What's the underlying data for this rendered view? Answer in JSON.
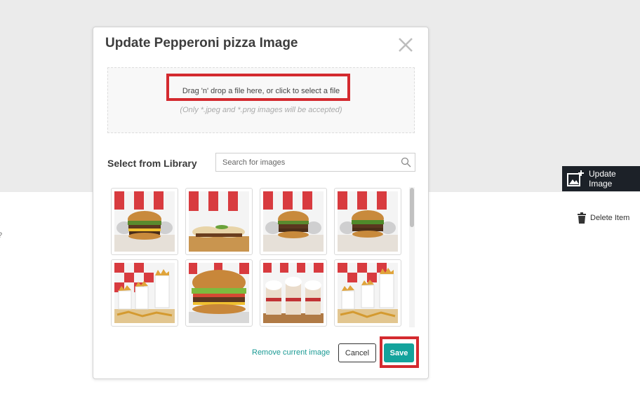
{
  "modal": {
    "title": "Update Pepperoni pizza Image",
    "dropzone": {
      "text": "Drag 'n' drop a file here, or click to select a file",
      "note": "(Only *.jpeg and *.png images will be accepted)"
    },
    "library": {
      "title": "Select from Library",
      "search_placeholder": "Search for images",
      "images": [
        {
          "icon": "burger-on-red-white-checker-background"
        },
        {
          "icon": "flattened-burger-on-red-white-checker-background"
        },
        {
          "icon": "burger-on-red-white-checker-background"
        },
        {
          "icon": "burger-on-red-white-checker-background"
        },
        {
          "icon": "fries-cups-on-red-checker-background"
        },
        {
          "icon": "burger-closeup"
        },
        {
          "icon": "milkshakes"
        },
        {
          "icon": "fries-cups-on-red-checker-background"
        }
      ]
    },
    "footer": {
      "remove_label": "Remove current image",
      "cancel_label": "Cancel",
      "save_label": "Save"
    }
  },
  "page": {
    "update_image_label": "Update Image",
    "delete_item_label": "Delete Item",
    "edge_text": "?"
  },
  "colors": {
    "accent": "#14a39c",
    "highlight": "#d42a2f",
    "dark_button": "#1c2128"
  }
}
